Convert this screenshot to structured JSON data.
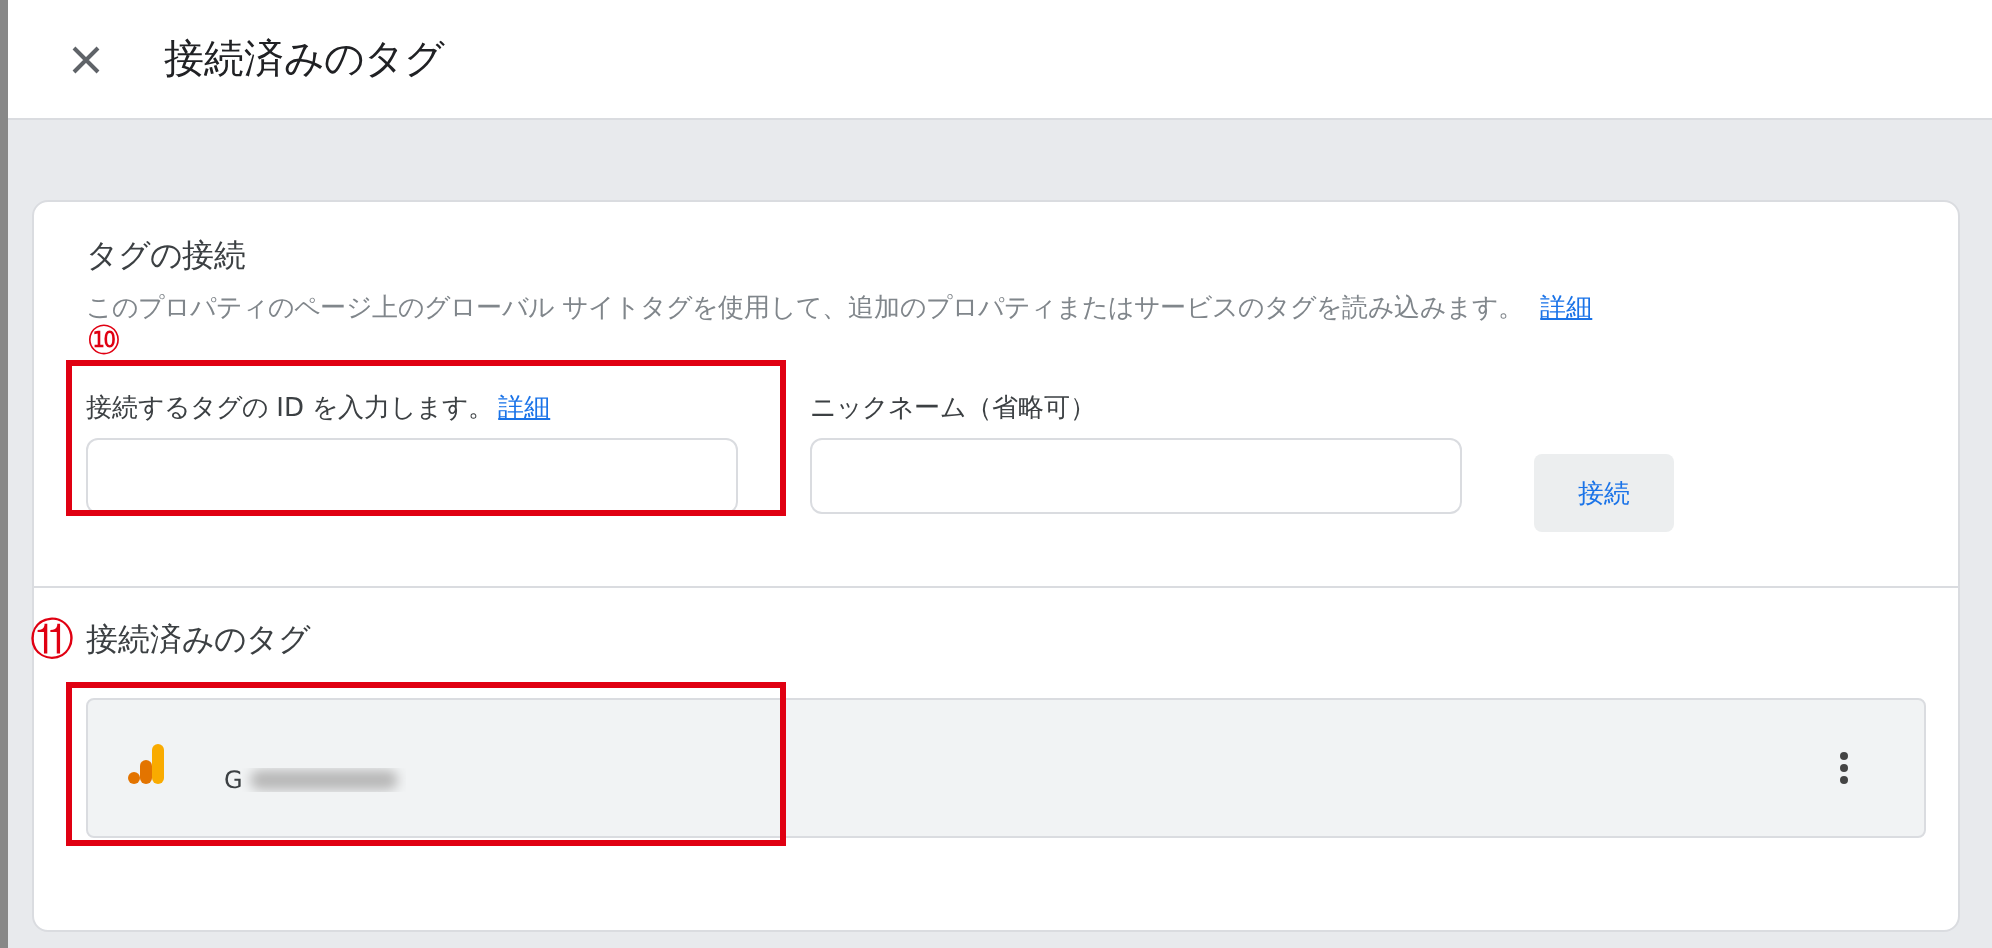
{
  "header": {
    "title": "接続済みのタグ"
  },
  "connect_section": {
    "title": "タグの接続",
    "description": "このプロパティのページ上のグローバル サイトタグを使用して、追加のプロパティまたはサービスのタグを読み込みます。",
    "description_link": "詳細",
    "annotation": "⑩",
    "tag_id_field": {
      "label": "接続するタグの ID を入力します。",
      "link": "詳細"
    },
    "nickname_field": {
      "label": "ニックネーム（省略可）"
    },
    "connect_button": "接続"
  },
  "connected_section": {
    "title": "接続済みのタグ",
    "annotation": "⑪",
    "tags": [
      {
        "id": "G"
      }
    ]
  }
}
